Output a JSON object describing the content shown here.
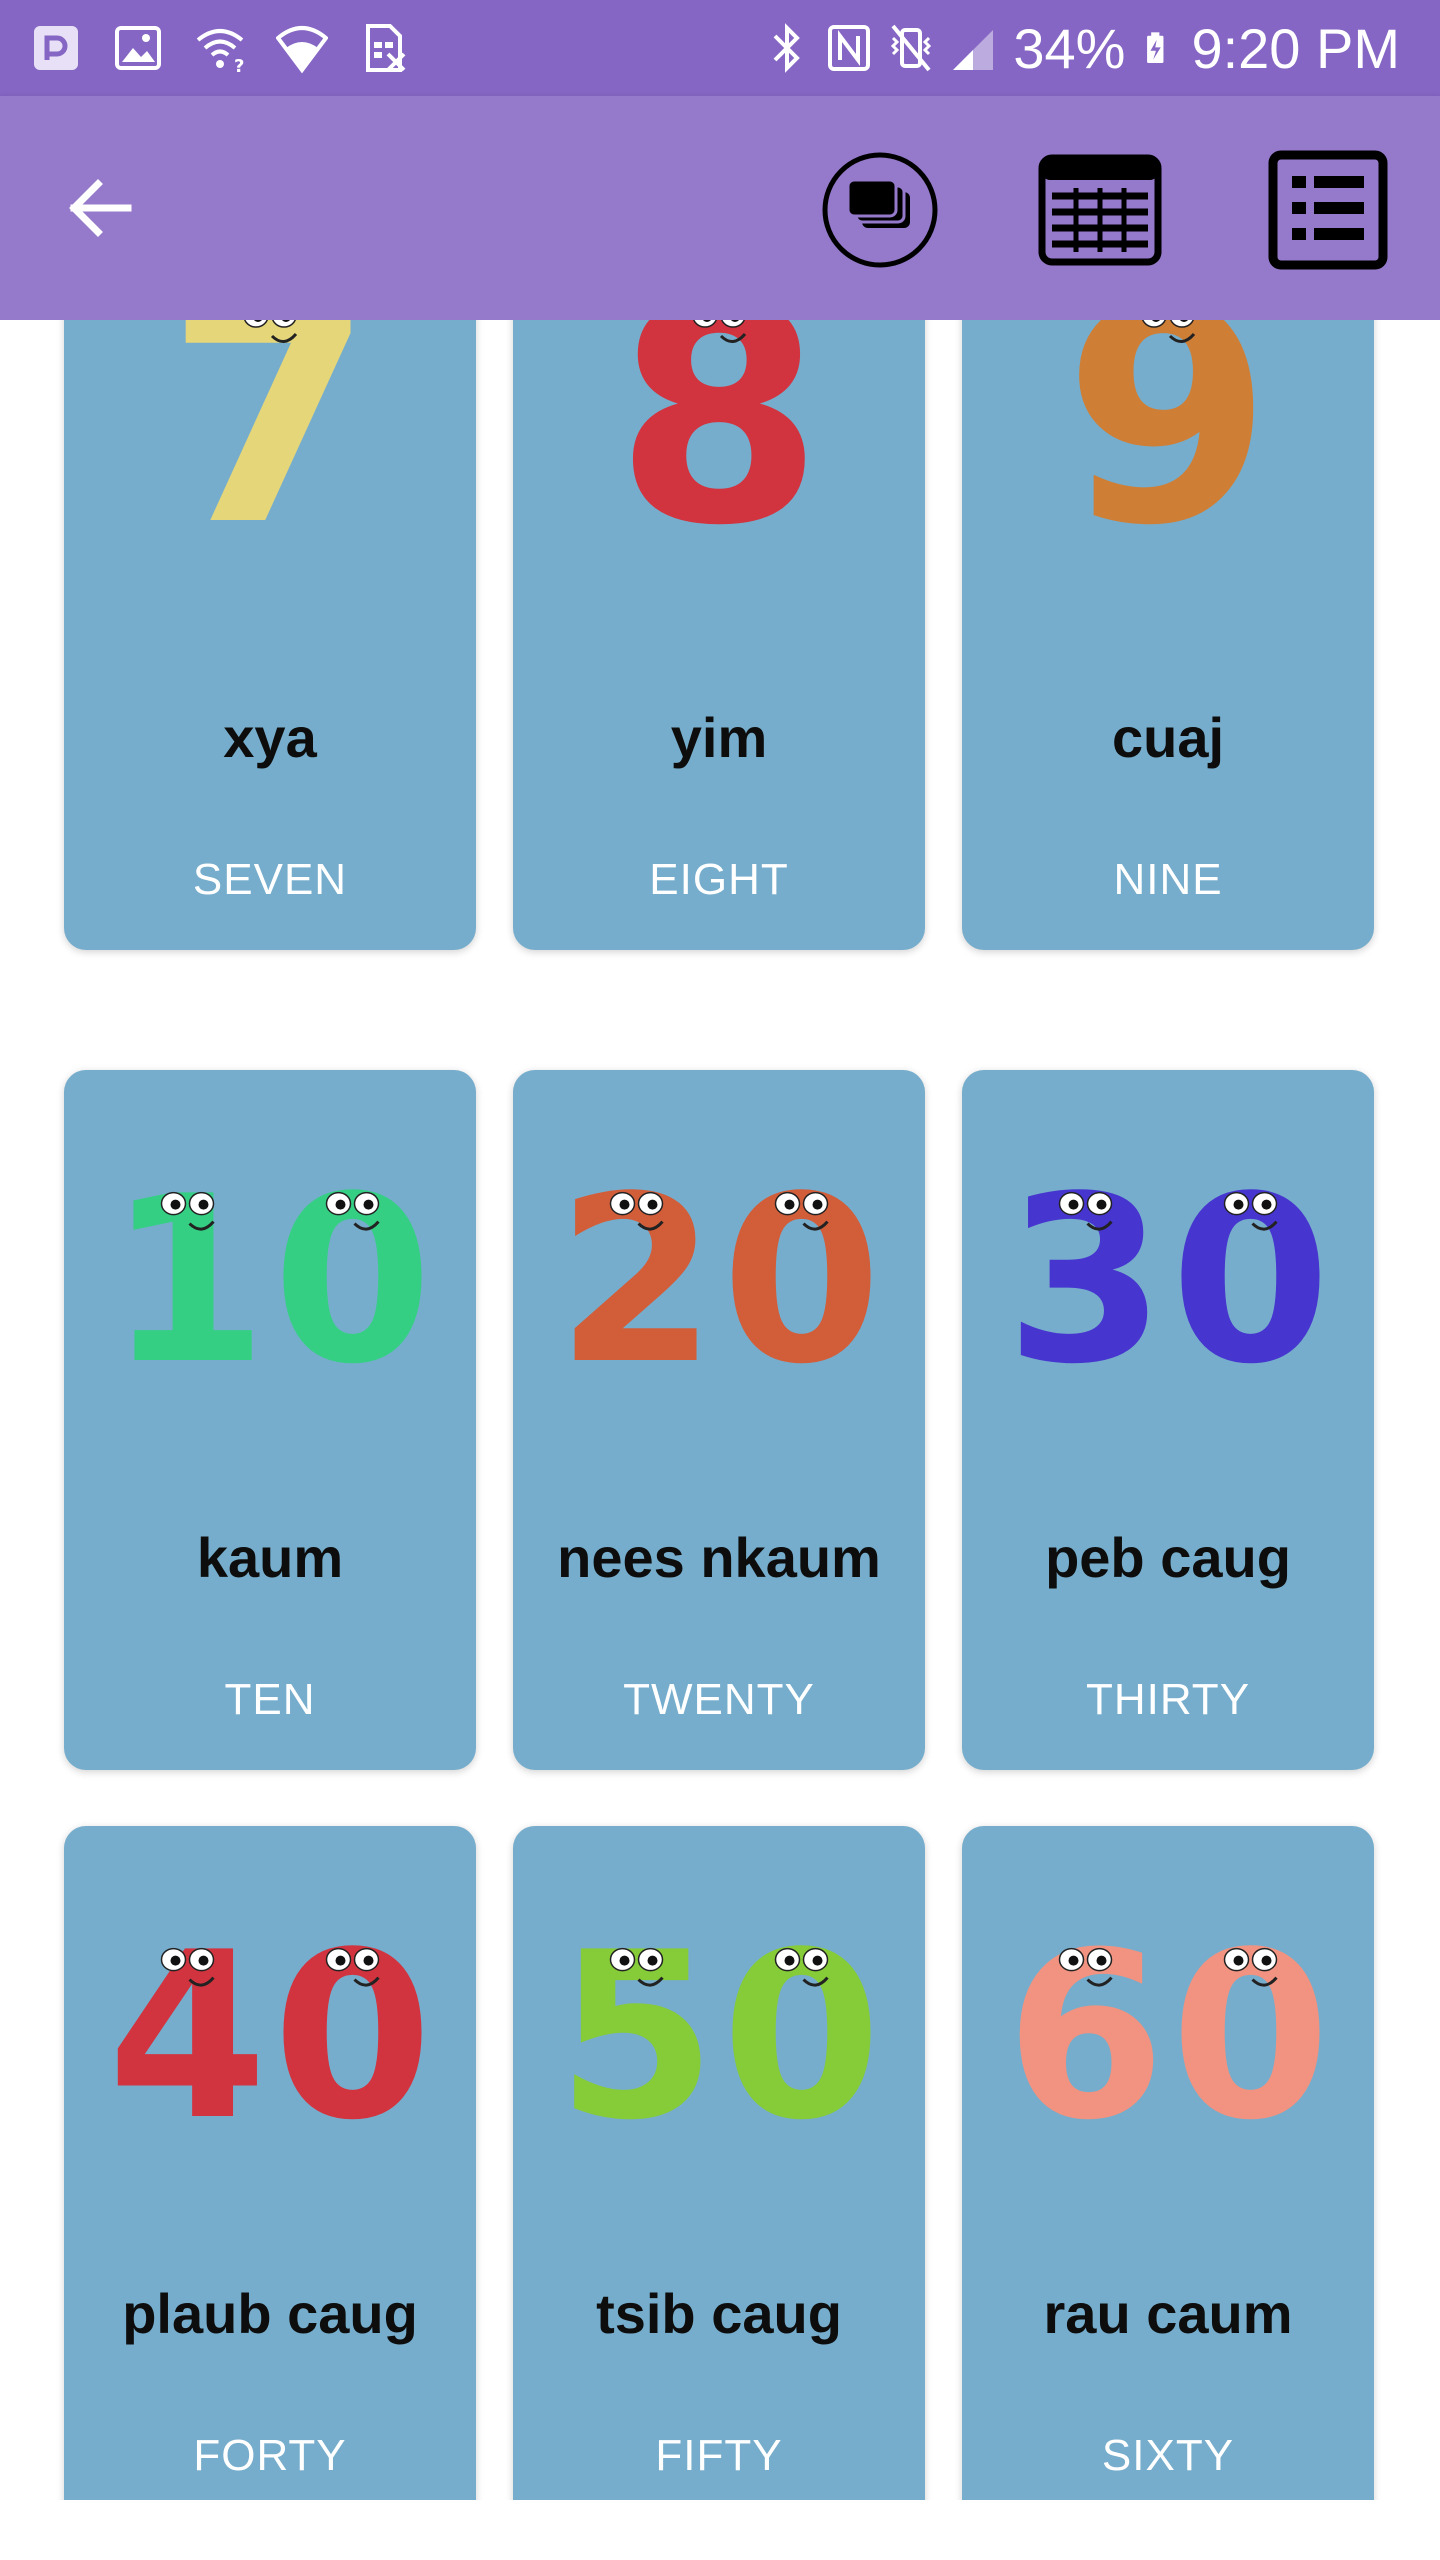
{
  "status_bar": {
    "left_icons": [
      "notification-app-icon",
      "image-icon",
      "wifi-question-icon",
      "wifi-icon",
      "sim-off-icon"
    ],
    "right_icons": [
      "bluetooth-icon",
      "nfc-icon",
      "vibrate-mute-icon",
      "signal-icon"
    ],
    "battery": "34%",
    "battery_icon": "battery-charging-icon",
    "time": "9:20 PM"
  },
  "app_bar": {
    "background": "#9579cb",
    "back_icon": "back-arrow-icon",
    "actions": [
      {
        "name": "flashcards-view-button",
        "icon": "cards-stack-icon"
      },
      {
        "name": "grid-view-button",
        "icon": "grid-table-icon"
      },
      {
        "name": "list-view-button",
        "icon": "list-icon"
      }
    ]
  },
  "cards": [
    {
      "numeral": "7",
      "word": "xya",
      "english": "SEVEN",
      "color": "#e5d67a"
    },
    {
      "numeral": "8",
      "word": "yim",
      "english": "EIGHT",
      "color": "#d1343f"
    },
    {
      "numeral": "9",
      "word": "cuaj",
      "english": "NINE",
      "color": "#cf7e35"
    },
    {
      "numeral": "10",
      "word": "kaum",
      "english": "TEN",
      "color": "#35cf84"
    },
    {
      "numeral": "20",
      "word": "nees nkaum",
      "english": "TWENTY",
      "color": "#d25d39"
    },
    {
      "numeral": "30",
      "word": "peb caug",
      "english": "THIRTY",
      "color": "#4636cf"
    },
    {
      "numeral": "40",
      "word": "plaub caug",
      "english": "FORTY",
      "color": "#d2343f"
    },
    {
      "numeral": "50",
      "word": "tsib caug",
      "english": "FIFTY",
      "color": "#85cc38"
    },
    {
      "numeral": "60",
      "word": "rau caum",
      "english": "SIXTY",
      "color": "#f19380"
    }
  ],
  "colors": {
    "status_bar": "#8566c4",
    "card_background": "#76adcc"
  }
}
